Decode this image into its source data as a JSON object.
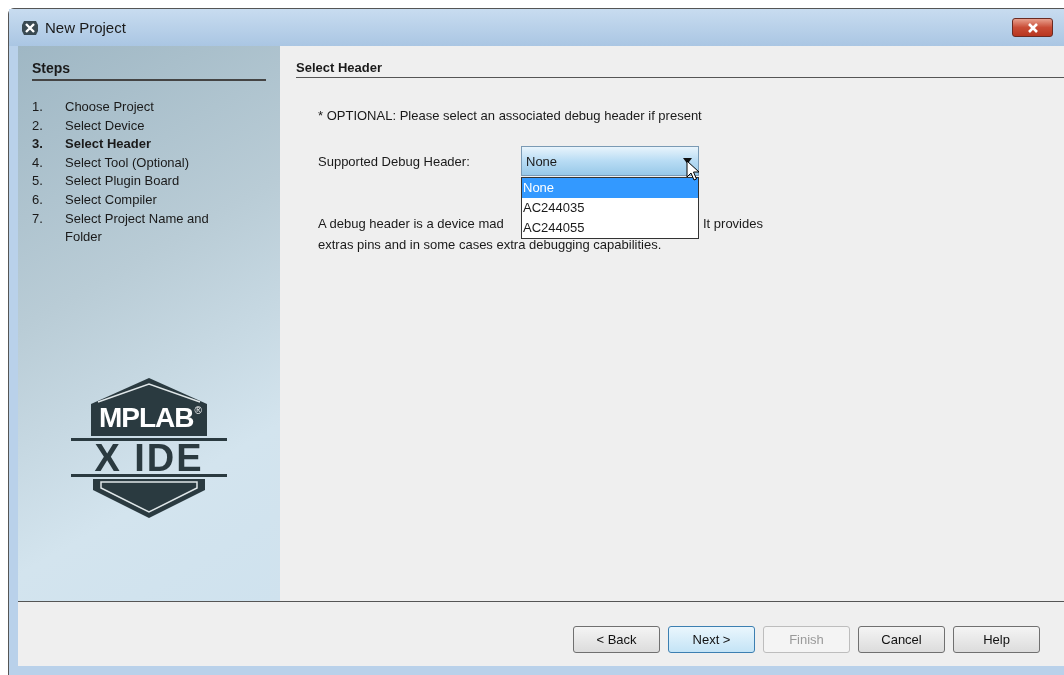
{
  "window": {
    "title": "New Project"
  },
  "steps": {
    "title": "Steps",
    "items": [
      {
        "number": "1.",
        "label": "Choose Project",
        "selected": false
      },
      {
        "number": "2.",
        "label": "Select Device",
        "selected": false
      },
      {
        "number": "3.",
        "label": "Select Header",
        "selected": true
      },
      {
        "number": "4.",
        "label": "Select Tool (Optional)",
        "selected": false
      },
      {
        "number": "5.",
        "label": "Select Plugin Board",
        "selected": false
      },
      {
        "number": "6.",
        "label": "Select Compiler",
        "selected": false
      },
      {
        "number": "7.",
        "label": "Select Project Name and Folder",
        "selected": false
      }
    ]
  },
  "logo": {
    "name": "MPLAB",
    "mark": "®",
    "subtitle": "X IDE"
  },
  "panel": {
    "title": "Select Header",
    "note": "* OPTIONAL: Please select an associated debug header if present",
    "field": {
      "label": "Supported Debug Header:",
      "value": "None",
      "options": [
        {
          "label": "None",
          "selected": true
        },
        {
          "label": "AC244035",
          "selected": false
        },
        {
          "label": "AC244055",
          "selected": false
        }
      ]
    },
    "description": {
      "line_1_start": "A debug header is a device mad",
      "line_1_end": "It provides",
      "line_2": "extras pins and in some cases extra debugging capabilities."
    }
  },
  "buttons": [
    {
      "label": "< Back",
      "kind": "normal"
    },
    {
      "label": "Next >",
      "kind": "default"
    },
    {
      "label": "Finish",
      "kind": "disabled"
    },
    {
      "label": "Cancel",
      "kind": "normal"
    },
    {
      "label": "Help",
      "kind": "normal"
    }
  ]
}
